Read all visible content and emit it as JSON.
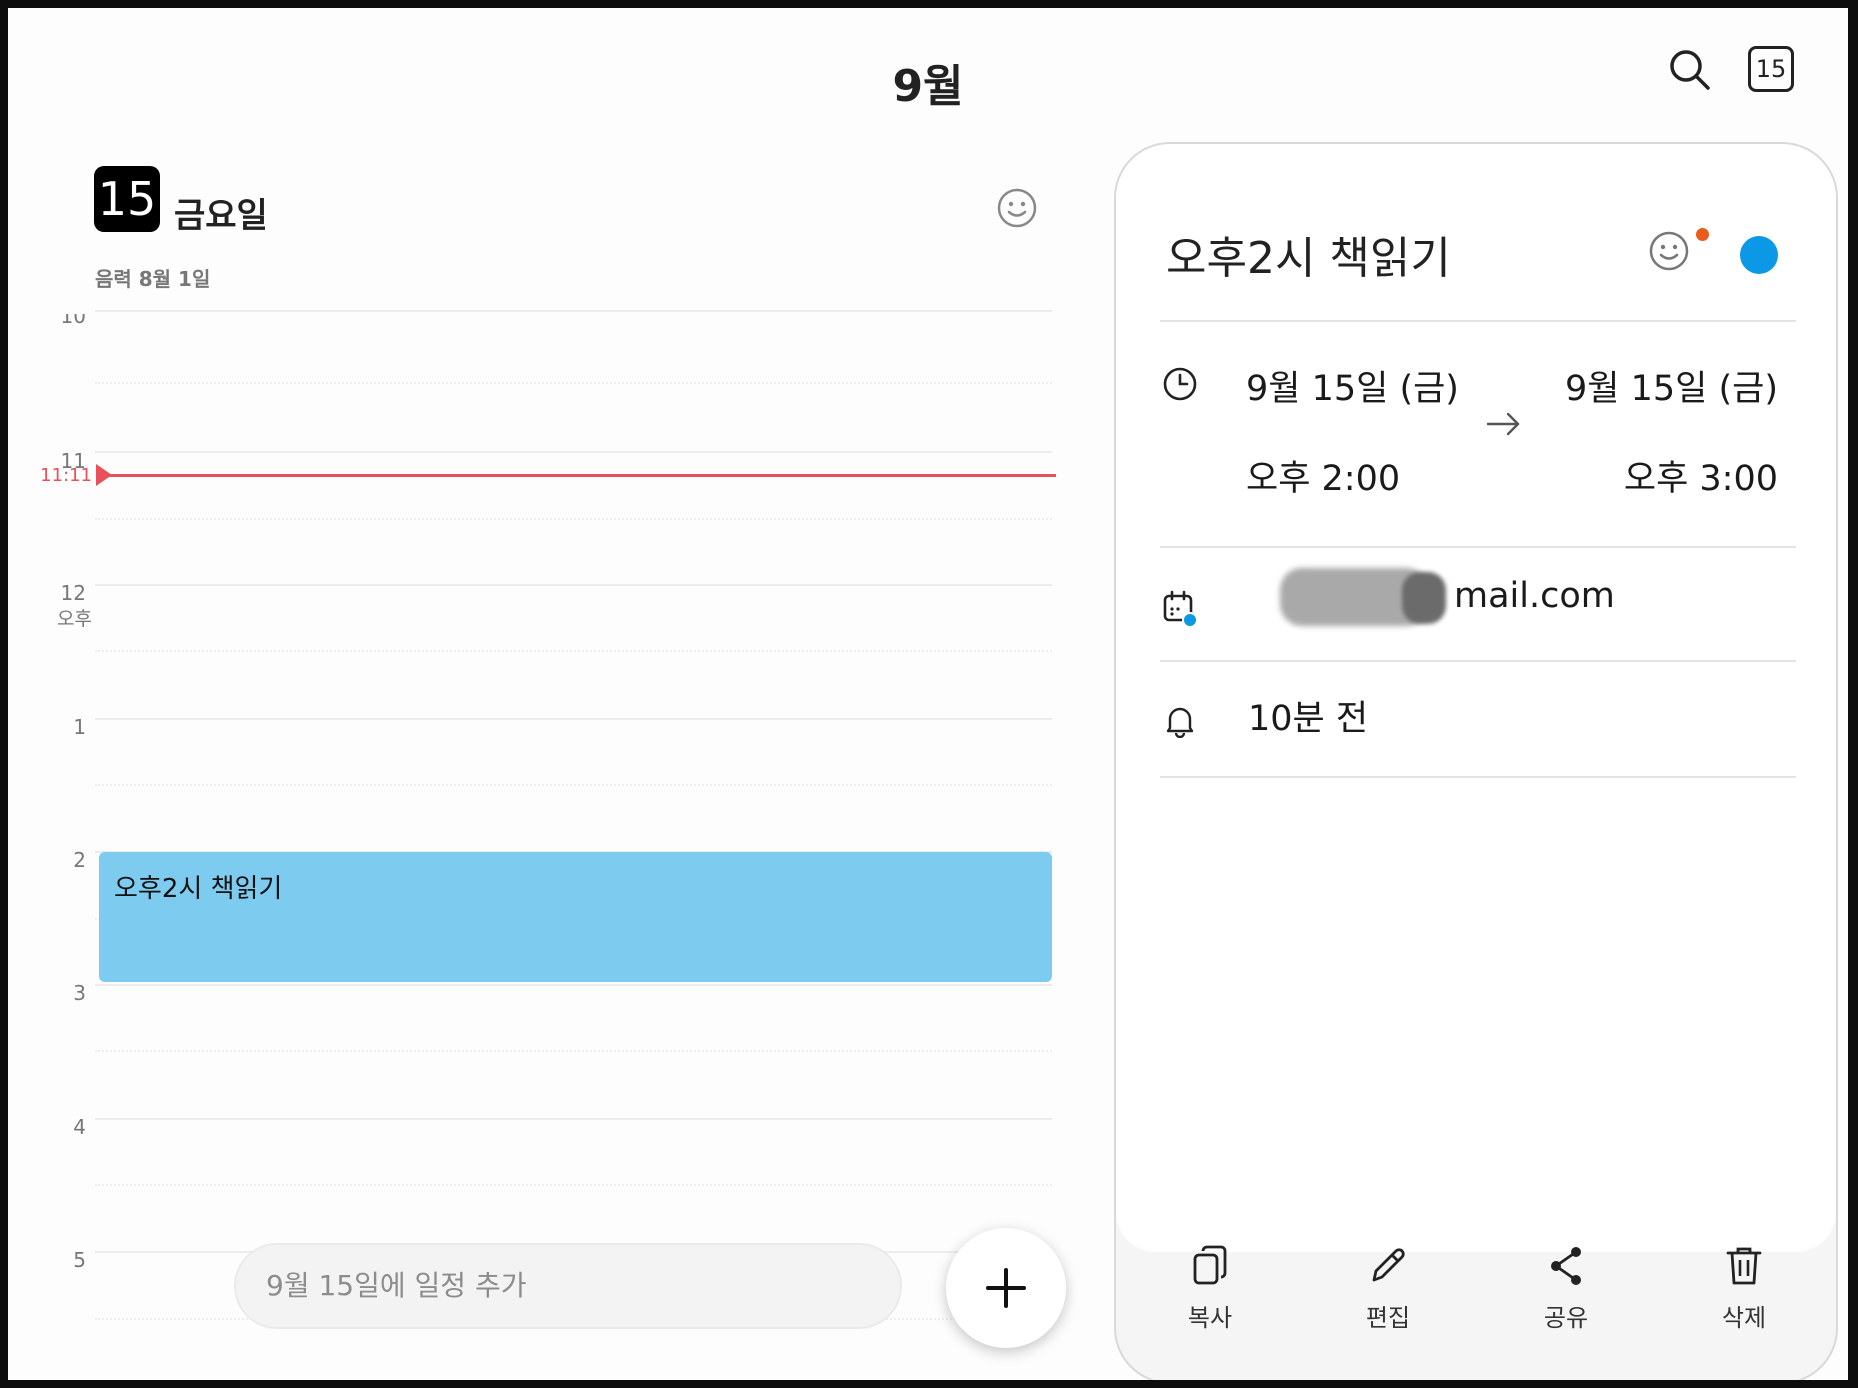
{
  "header": {
    "month_title": "9월",
    "today_badge": "15"
  },
  "day_view": {
    "date_number": "15",
    "weekday": "금요일",
    "lunar_date": "음력 8월 1일",
    "hours": [
      "10",
      "11",
      "12",
      "1",
      "2",
      "3",
      "4",
      "5"
    ],
    "pm_label": "오후",
    "current_time": "11:11",
    "event": {
      "title": "오후2시 책읽기",
      "color": "#7ecbf0"
    },
    "add_placeholder": "9월 15일에 일정 추가"
  },
  "detail": {
    "title": "오후2시 책읽기",
    "calendar_color": "#0b98e6",
    "start_date": "9월 15일 (금)",
    "start_time": "오후 2:00",
    "end_date": "9월 15일 (금)",
    "end_time": "오후 3:00",
    "account_visible": "mail.com",
    "reminder": "10분 전",
    "actions": {
      "copy": "복사",
      "edit": "편집",
      "share": "공유",
      "delete": "삭제"
    }
  },
  "colors": {
    "now_line": "#e8505b",
    "notification_dot": "#ea5c1c"
  }
}
